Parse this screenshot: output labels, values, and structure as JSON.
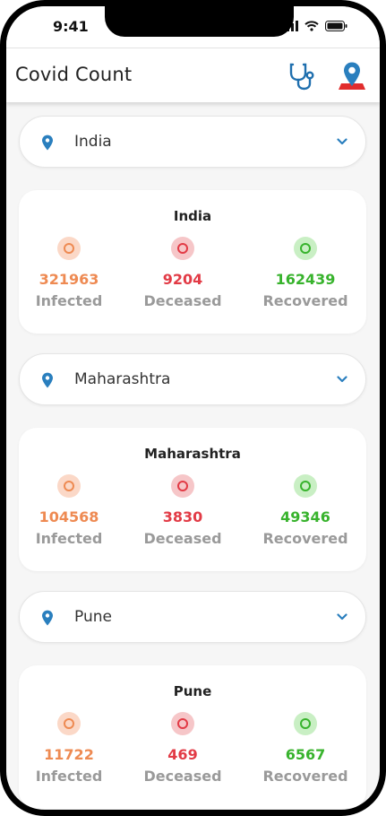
{
  "status_bar": {
    "time": "9:41"
  },
  "app": {
    "title": "Covid Count"
  },
  "icons": {
    "stethoscope": "stethoscope-icon",
    "map_pin_flag": "location-pin-icon",
    "pin": "location-pin-icon",
    "chevron": "chevron-down-icon"
  },
  "colors": {
    "accent_blue": "#2a7fbe",
    "infected": "#ee8a52",
    "deceased": "#e23b46",
    "recovered": "#38b32d",
    "label_gray": "#9a9a9a"
  },
  "sections": [
    {
      "selector": "India",
      "card": {
        "title": "India",
        "infected": "321963",
        "infected_label": "Infected",
        "deceased": "9204",
        "deceased_label": "Deceased",
        "recovered": "162439",
        "recovered_label": "Recovered"
      }
    },
    {
      "selector": "Maharashtra",
      "card": {
        "title": "Maharashtra",
        "infected": "104568",
        "infected_label": "Infected",
        "deceased": "3830",
        "deceased_label": "Deceased",
        "recovered": "49346",
        "recovered_label": "Recovered"
      }
    },
    {
      "selector": "Pune",
      "card": {
        "title": "Pune",
        "infected": "11722",
        "infected_label": "Infected",
        "deceased": "469",
        "deceased_label": "Deceased",
        "recovered": "6567",
        "recovered_label": "Recovered"
      }
    }
  ]
}
